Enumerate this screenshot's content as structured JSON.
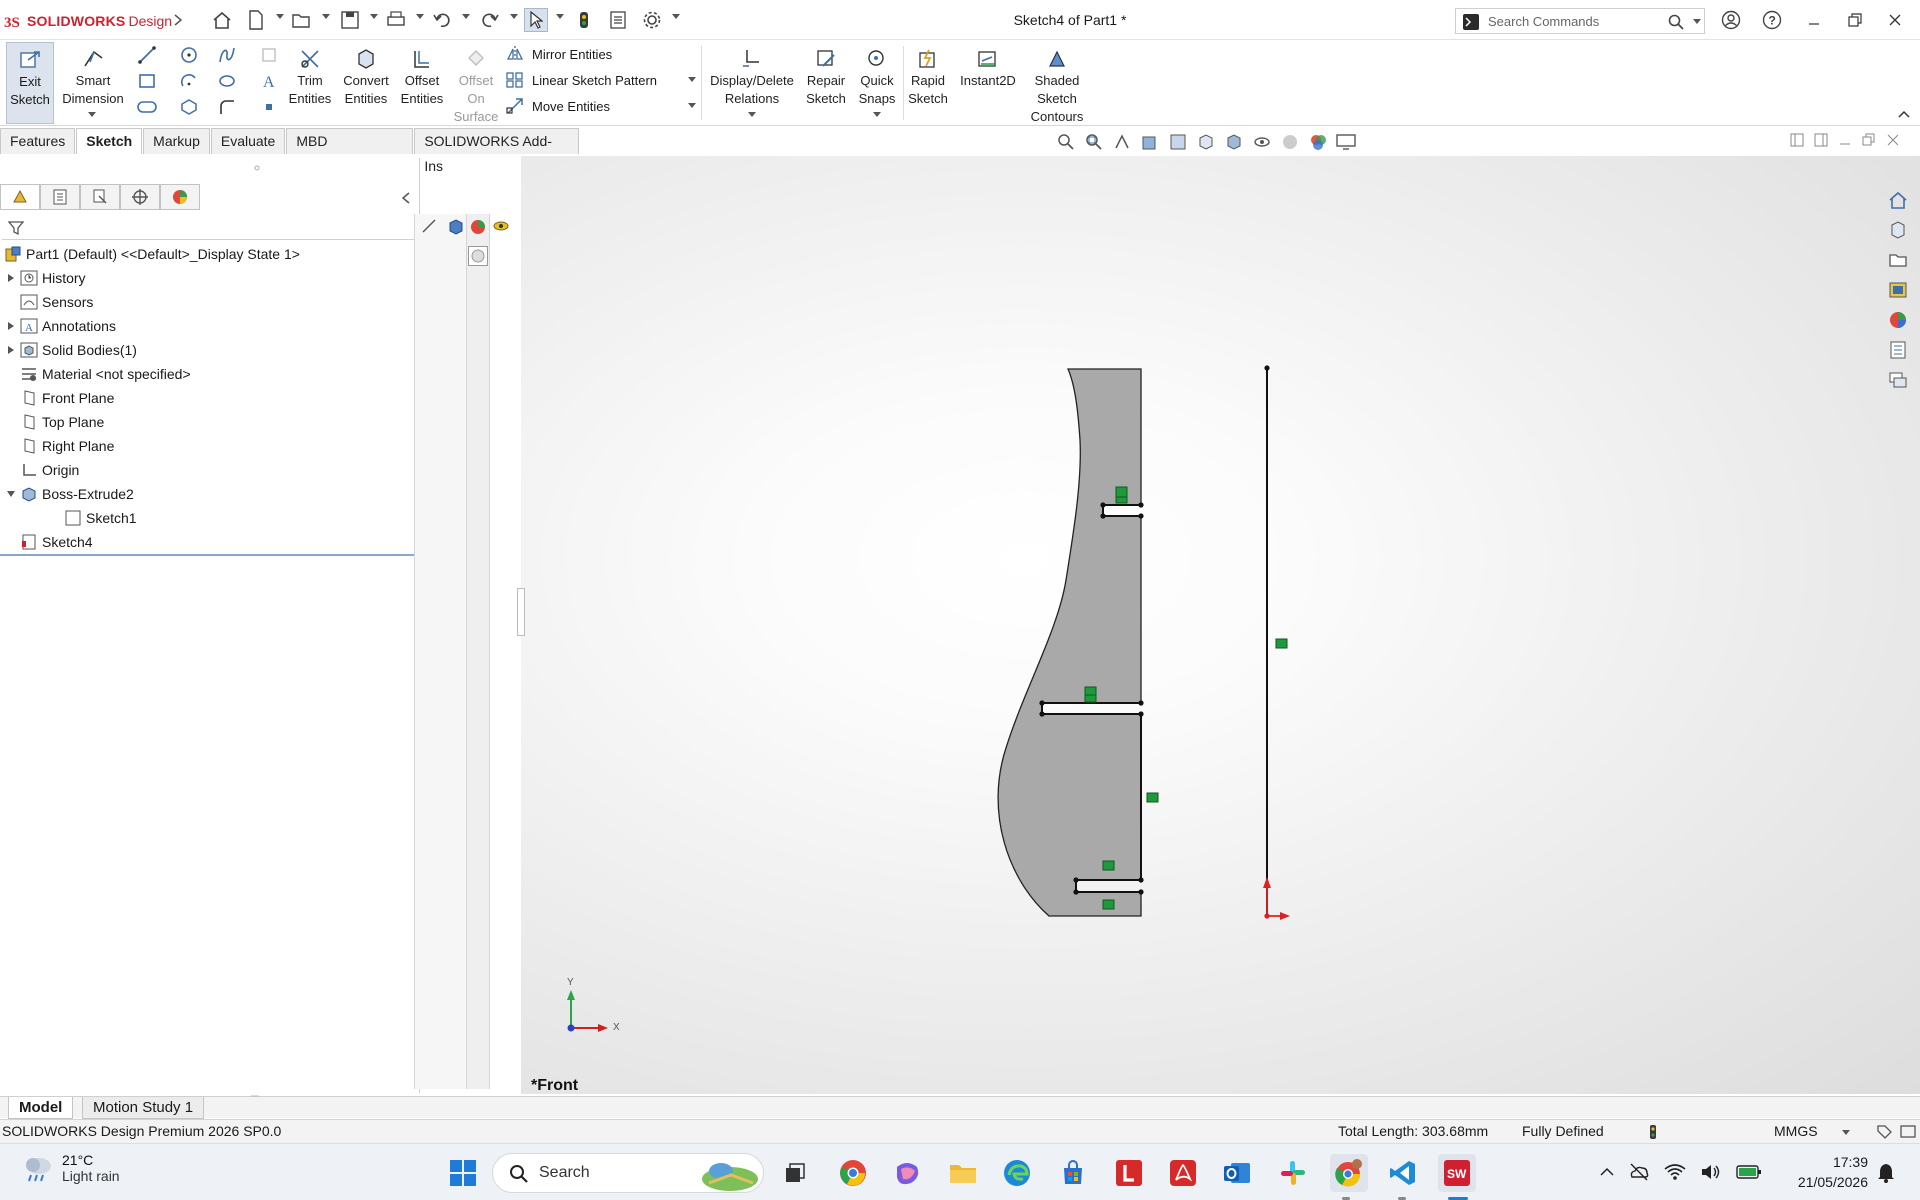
{
  "app": {
    "brand_a": "SOLIDWORKS",
    "brand_b": "Design",
    "title": "Sketch4 of Part1 *"
  },
  "search": {
    "placeholder": "Search Commands"
  },
  "ribbon": {
    "exit_sketch": [
      "Exit",
      "Sketch"
    ],
    "smart_dimension": [
      "Smart",
      "Dimension"
    ],
    "trim": [
      "Trim",
      "Entities"
    ],
    "convert": [
      "Convert",
      "Entities"
    ],
    "offset": [
      "Offset",
      "Entities"
    ],
    "offset_surface": [
      "Offset",
      "On",
      "Surface"
    ],
    "mirror": "Mirror Entities",
    "linear_pattern": "Linear Sketch Pattern",
    "move": "Move Entities",
    "display_delete": [
      "Display/Delete",
      "Relations"
    ],
    "repair": [
      "Repair",
      "Sketch"
    ],
    "quick_snaps": [
      "Quick",
      "Snaps"
    ],
    "rapid": [
      "Rapid",
      "Sketch"
    ],
    "instant2d": "Instant2D",
    "shaded": [
      "Shaded",
      "Sketch",
      "Contours"
    ]
  },
  "tabs": [
    "Features",
    "Sketch",
    "Markup",
    "Evaluate",
    "MBD Dimensions",
    "SOLIDWORKS Add-Ins"
  ],
  "active_tab": "Sketch",
  "tree": [
    {
      "label": "Part1 (Default) <<Default>_Display State 1>",
      "icon": "part-icon",
      "expand": ""
    },
    {
      "label": "History",
      "icon": "history-icon",
      "expand": "collapsed"
    },
    {
      "label": "Sensors",
      "icon": "sensors-icon",
      "expand": ""
    },
    {
      "label": "Annotations",
      "icon": "annotations-icon",
      "expand": "collapsed"
    },
    {
      "label": "Solid Bodies(1)",
      "icon": "solid-bodies-icon",
      "expand": "collapsed"
    },
    {
      "label": "Material <not specified>",
      "icon": "material-icon",
      "expand": ""
    },
    {
      "label": "Front Plane",
      "icon": "plane-icon",
      "expand": ""
    },
    {
      "label": "Top Plane",
      "icon": "plane-icon",
      "expand": ""
    },
    {
      "label": "Right Plane",
      "icon": "plane-icon",
      "expand": ""
    },
    {
      "label": "Origin",
      "icon": "origin-icon",
      "expand": ""
    },
    {
      "label": "Boss-Extrude2",
      "icon": "boss-extrude-icon",
      "expand": "expanded"
    },
    {
      "label": "Sketch1",
      "icon": "sketch-icon",
      "expand": ""
    },
    {
      "label": "Sketch4",
      "icon": "sketch-active-icon",
      "expand": ""
    }
  ],
  "viewport": {
    "view_label": "*Front",
    "axis_x": "X",
    "axis_y": "Y"
  },
  "bottom_tabs": [
    "Model",
    "Motion Study 1"
  ],
  "status": {
    "product": "SOLIDWORKS Design Premium 2026 SP0.0",
    "total_length": "Total Length: 303.68mm",
    "state": "Fully Defined",
    "units": "MMGS"
  },
  "taskbar": {
    "temperature": "21°C",
    "weather": "Light rain",
    "search": "Search",
    "time": "17:39",
    "date": "21/05/2026"
  },
  "colors": {
    "brand_red": "#d0202f",
    "sketch_fill": "#a8a8a8",
    "relation_green": "#1e9a3c",
    "origin_red": "#e02020"
  }
}
